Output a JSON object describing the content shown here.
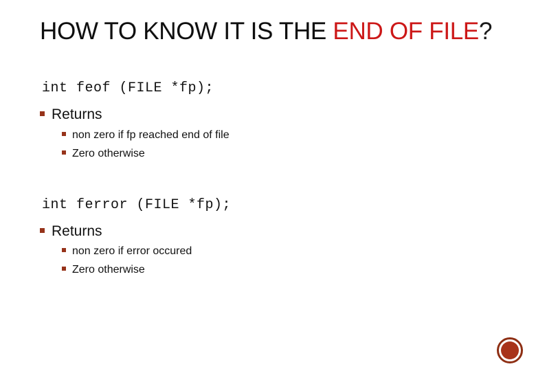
{
  "slide": {
    "background_color": "#ffffff",
    "title": {
      "lead_text": "HOW TO KNOW IT IS THE ",
      "highlight_text": "END OF FILE",
      "trailing_text": "?",
      "highlight_color": "#cc1717",
      "lead_color": "#1a1a1a"
    },
    "bullet_color": "#96331a",
    "sections": [
      {
        "code": "int feof (FILE *fp);",
        "heading": "Returns",
        "items": [
          "non zero if fp reached end of file",
          "Zero otherwise"
        ]
      },
      {
        "code": "int ferror (FILE *fp);",
        "heading": "Returns",
        "items": [
          "non zero if error occured",
          "Zero otherwise"
        ]
      }
    ],
    "decoration": {
      "name": "circle-mark",
      "ring_color": "#8e2f14",
      "fill_color": "#a8331a"
    }
  }
}
